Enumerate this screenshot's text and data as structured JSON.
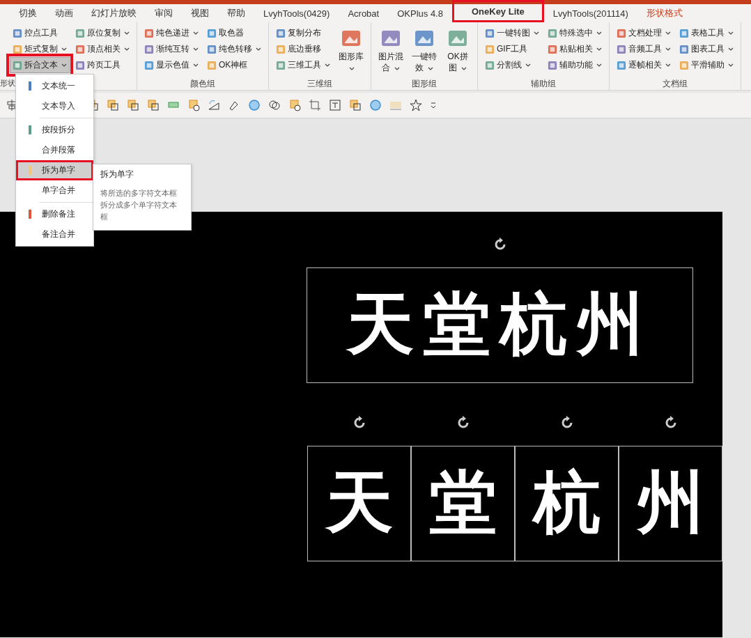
{
  "tabs": [
    {
      "label": "切换",
      "selected": false,
      "annotated": false,
      "kind": "normal"
    },
    {
      "label": "动画",
      "selected": false,
      "annotated": false,
      "kind": "normal"
    },
    {
      "label": "幻灯片放映",
      "selected": false,
      "annotated": false,
      "kind": "normal"
    },
    {
      "label": "审阅",
      "selected": false,
      "annotated": false,
      "kind": "normal"
    },
    {
      "label": "视图",
      "selected": false,
      "annotated": false,
      "kind": "normal"
    },
    {
      "label": "帮助",
      "selected": false,
      "annotated": false,
      "kind": "normal"
    },
    {
      "label": "LvyhTools(0429)",
      "selected": false,
      "annotated": false,
      "kind": "normal"
    },
    {
      "label": "Acrobat",
      "selected": false,
      "annotated": false,
      "kind": "normal"
    },
    {
      "label": "OKPlus 4.8",
      "selected": false,
      "annotated": false,
      "kind": "normal"
    },
    {
      "label": "OneKey Lite",
      "selected": true,
      "annotated": true,
      "kind": "normal"
    },
    {
      "label": "LvyhTools(201114)",
      "selected": false,
      "annotated": false,
      "kind": "normal"
    },
    {
      "label": "形状格式",
      "selected": false,
      "annotated": false,
      "kind": "contextual"
    }
  ],
  "ribbon": {
    "groups": [
      {
        "label": "形状",
        "columns": [
          {
            "kind": "small",
            "items": [
              {
                "label": "控点工具",
                "dropdown": false,
                "pressed": false,
                "annotated": false
              },
              {
                "label": "矩式复制",
                "dropdown": true,
                "pressed": false,
                "annotated": false
              },
              {
                "label": "拆合文本",
                "dropdown": true,
                "pressed": true,
                "annotated": true
              }
            ]
          },
          {
            "kind": "small",
            "items": [
              {
                "label": "原位复制",
                "dropdown": true,
                "pressed": false,
                "annotated": false
              },
              {
                "label": "顶点相关",
                "dropdown": true,
                "pressed": false,
                "annotated": false
              },
              {
                "label": "跨页工具",
                "dropdown": false,
                "pressed": false,
                "annotated": false
              }
            ]
          }
        ]
      },
      {
        "label": "颜色组",
        "columns": [
          {
            "kind": "small",
            "items": [
              {
                "label": "纯色递进",
                "dropdown": true,
                "pressed": false,
                "annotated": false
              },
              {
                "label": "渐纯互转",
                "dropdown": true,
                "pressed": false,
                "annotated": false
              },
              {
                "label": "显示色值",
                "dropdown": true,
                "pressed": false,
                "annotated": false
              }
            ]
          },
          {
            "kind": "small",
            "items": [
              {
                "label": "取色器",
                "dropdown": false,
                "pressed": false,
                "annotated": false
              },
              {
                "label": "纯色转移",
                "dropdown": true,
                "pressed": false,
                "annotated": false
              },
              {
                "label": "OK神框",
                "dropdown": false,
                "pressed": false,
                "annotated": false
              }
            ]
          }
        ]
      },
      {
        "label": "三维组",
        "columns": [
          {
            "kind": "small",
            "items": [
              {
                "label": "复制分布",
                "dropdown": false,
                "pressed": false,
                "annotated": false
              },
              {
                "label": "底边垂移",
                "dropdown": false,
                "pressed": false,
                "annotated": false
              },
              {
                "label": "三维工具",
                "dropdown": true,
                "pressed": false,
                "annotated": false
              }
            ]
          },
          {
            "kind": "large",
            "items": [
              {
                "label": "图形库",
                "dropdown": true,
                "pressed": false,
                "annotated": false
              }
            ]
          }
        ]
      },
      {
        "label": "图形组",
        "columns": [
          {
            "kind": "large",
            "items": [
              {
                "label": "图片混合",
                "dropdown": true,
                "pressed": false,
                "annotated": false
              }
            ]
          },
          {
            "kind": "large",
            "items": [
              {
                "label": "一键特效",
                "dropdown": true,
                "pressed": false,
                "annotated": false
              }
            ]
          },
          {
            "kind": "large",
            "items": [
              {
                "label": "OK拼图",
                "dropdown": true,
                "pressed": false,
                "annotated": false
              }
            ]
          }
        ]
      },
      {
        "label": "辅助组",
        "columns": [
          {
            "kind": "small",
            "items": [
              {
                "label": "一键转图",
                "dropdown": true,
                "pressed": false,
                "annotated": false
              },
              {
                "label": "GIF工具",
                "dropdown": false,
                "pressed": false,
                "annotated": false
              },
              {
                "label": "分割线",
                "dropdown": true,
                "pressed": false,
                "annotated": false
              }
            ]
          },
          {
            "kind": "small",
            "items": [
              {
                "label": "特殊选中",
                "dropdown": true,
                "pressed": false,
                "annotated": false
              },
              {
                "label": "粘贴相关",
                "dropdown": true,
                "pressed": false,
                "annotated": false
              },
              {
                "label": "辅助功能",
                "dropdown": true,
                "pressed": false,
                "annotated": false
              }
            ]
          }
        ]
      },
      {
        "label": "文档组",
        "columns": [
          {
            "kind": "small",
            "items": [
              {
                "label": "文档处理",
                "dropdown": true,
                "pressed": false,
                "annotated": false
              },
              {
                "label": "音频工具",
                "dropdown": true,
                "pressed": false,
                "annotated": false
              },
              {
                "label": "逐帧相关",
                "dropdown": true,
                "pressed": false,
                "annotated": false
              }
            ]
          },
          {
            "kind": "small",
            "items": [
              {
                "label": "表格工具",
                "dropdown": true,
                "pressed": false,
                "annotated": false
              },
              {
                "label": "图表工具",
                "dropdown": true,
                "pressed": false,
                "annotated": false
              },
              {
                "label": "平滑辅助",
                "dropdown": true,
                "pressed": false,
                "annotated": false
              }
            ]
          }
        ]
      }
    ]
  },
  "menu": {
    "sections": [
      [
        {
          "label": "文本统一",
          "color": "#4a7ebf",
          "selected": false,
          "annotated": false
        },
        {
          "label": "文本导入",
          "selected": false,
          "annotated": false
        }
      ],
      [
        {
          "label": "按段拆分",
          "color": "#5f9e86",
          "selected": false,
          "annotated": false
        },
        {
          "label": "合并段落",
          "selected": false,
          "annotated": false
        },
        {
          "label": "拆为单字",
          "color": "#f2c77a",
          "selected": true,
          "annotated": true
        },
        {
          "label": "单字合并",
          "selected": false,
          "annotated": false
        }
      ],
      [
        {
          "label": "删除备注",
          "color": "#d9573a",
          "selected": false,
          "annotated": false
        },
        {
          "label": "备注合并",
          "selected": false,
          "annotated": false
        }
      ]
    ]
  },
  "tooltip": {
    "title": "拆为单字",
    "description": "将所选的多字符文本框拆分成多个单字符文本框"
  },
  "slide": {
    "text_box": "天堂杭州",
    "split_boxes": [
      "天",
      "堂",
      "杭",
      "州"
    ]
  }
}
